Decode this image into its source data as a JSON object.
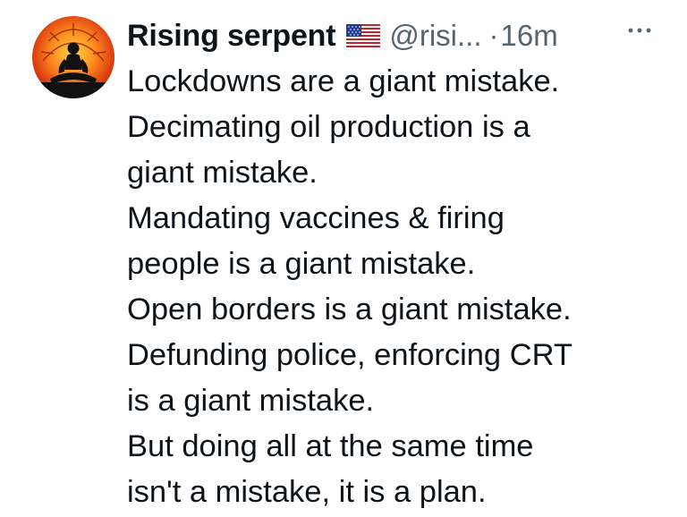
{
  "tweet": {
    "author": {
      "display_name": "Rising serpent",
      "flag_icon": "us-flag-icon",
      "handle": "@risi...",
      "separator": "·",
      "timestamp": "16m",
      "avatar_icon": "meditating-silhouette-avatar"
    },
    "more_icon": "ellipsis-icon",
    "text_lines": [
      "Lockdowns are a giant mistake.",
      "Decimating oil production is a",
      "giant mistake.",
      "Mandating vaccines & firing",
      "people is a giant mistake.",
      "Open borders is a giant mistake.",
      "Defunding police, enforcing CRT",
      "is a giant mistake.",
      "But doing all at the same time",
      "isn't a mistake, it is a plan."
    ]
  },
  "colors": {
    "text": "#0f1419",
    "secondary": "#536471",
    "background": "#ffffff"
  }
}
